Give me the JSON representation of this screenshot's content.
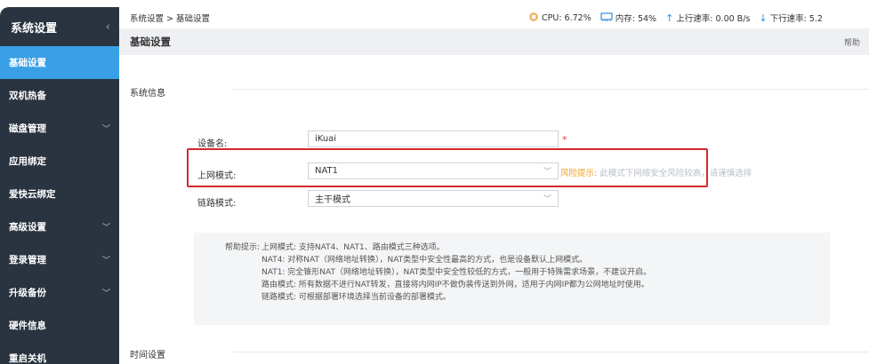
{
  "sidebar": {
    "title": "系统设置",
    "collapse_icon": "‹",
    "items": [
      {
        "label": "基础设置",
        "active": true,
        "has_arrow": false
      },
      {
        "label": "双机热备",
        "active": false,
        "has_arrow": false
      },
      {
        "label": "磁盘管理",
        "active": false,
        "has_arrow": true
      },
      {
        "label": "应用绑定",
        "active": false,
        "has_arrow": false
      },
      {
        "label": "爱快云绑定",
        "active": false,
        "has_arrow": false
      },
      {
        "label": "高级设置",
        "active": false,
        "has_arrow": true
      },
      {
        "label": "登录管理",
        "active": false,
        "has_arrow": true
      },
      {
        "label": "升级备份",
        "active": false,
        "has_arrow": true
      },
      {
        "label": "硬件信息",
        "active": false,
        "has_arrow": false
      },
      {
        "label": "重启关机",
        "active": false,
        "has_arrow": false
      }
    ]
  },
  "topbar": {
    "breadcrumb": "系统设置 > 基础设置",
    "cpu": "CPU: 6.72%",
    "memory": "内存: 54%",
    "upload": "上行速率: 0.00 B/s",
    "download": "下行速率: 5.2"
  },
  "page": {
    "title": "基础设置",
    "help": "帮助"
  },
  "sections": {
    "system_info": "系统信息",
    "time_settings": "时间设置"
  },
  "form": {
    "device_name_label": "设备名:",
    "device_name_value": "iKuai",
    "required_mark": "*",
    "network_mode_label": "上网模式:",
    "network_mode_value": "NAT1",
    "link_mode_label": "链路模式:",
    "link_mode_value": "主干模式"
  },
  "risk": {
    "label": "风险提示:",
    "text": "此模式下网络安全风险较高，请谨慎选择"
  },
  "help_box": {
    "rows": [
      {
        "key": "帮助提示:",
        "val": "上网模式: 支持NAT4、NAT1、路由模式三种选项。"
      },
      {
        "key": "",
        "val": "NAT4: 对称NAT（网络地址转换），NAT类型中安全性最高的方式，也是设备默认上网模式。"
      },
      {
        "key": "",
        "val": "NAT1: 完全锥形NAT（网络地址转换），NAT类型中安全性较低的方式，一般用于特殊需求场景，不建议开启。"
      },
      {
        "key": "",
        "val": "路由模式: 所有数据不进行NAT转发，直接将内网IP不做伪装传送到外网，适用于内网IP都为公网地址时使用。"
      },
      {
        "key": "",
        "val": "链路模式: 可根据部署环境选择当前设备的部署模式。"
      }
    ]
  },
  "colors": {
    "sidebar_bg": "#2a3440",
    "active_item": "#3aa0e6",
    "highlight_border": "#d6282a",
    "risk_label": "#f0a020"
  },
  "icons": {
    "cpu": "cpu-icon",
    "memory": "memory-icon",
    "upload": "arrow-up-icon",
    "download": "arrow-down-icon"
  }
}
